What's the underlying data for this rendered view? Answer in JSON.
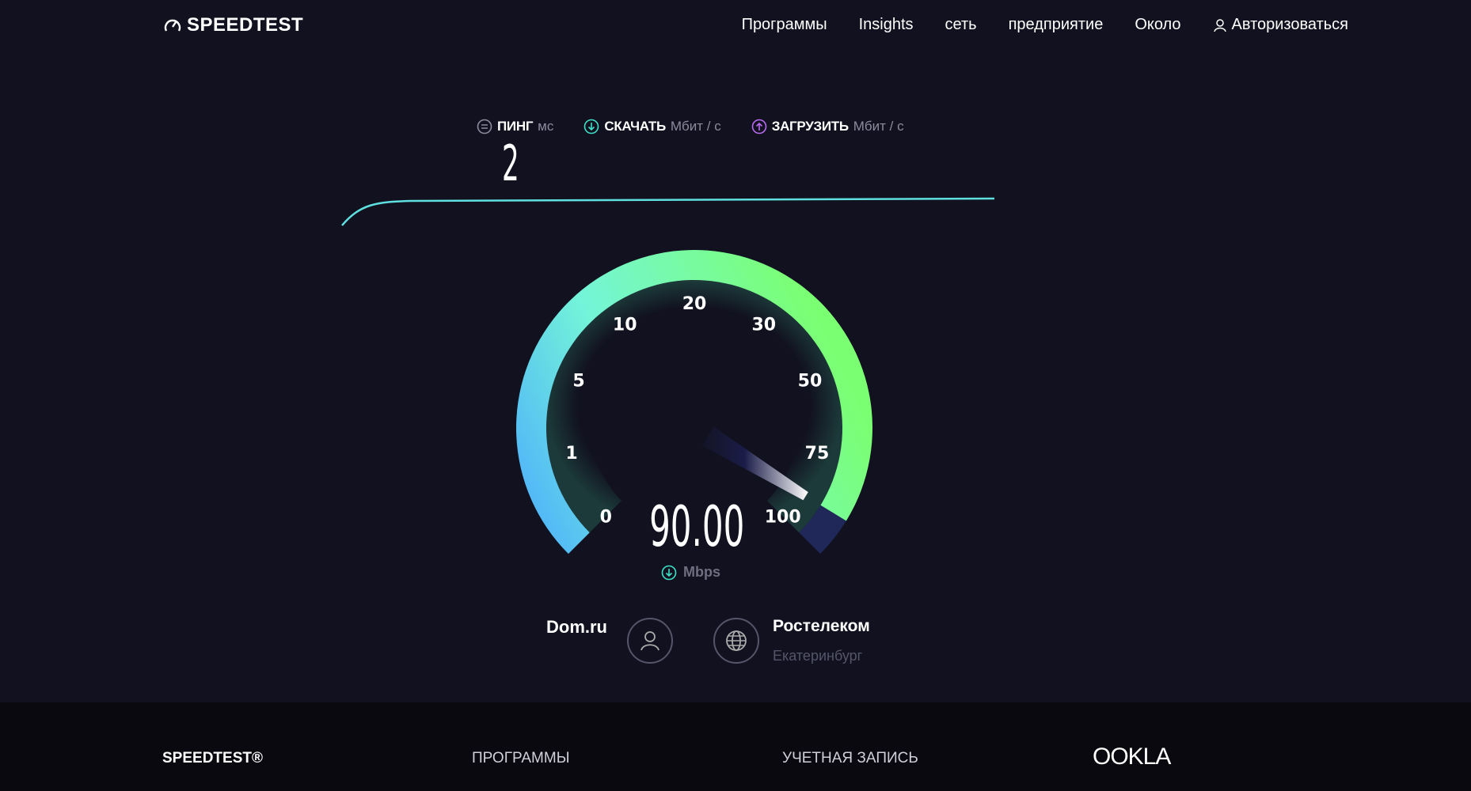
{
  "header": {
    "logo": "SPEEDTEST",
    "nav": [
      "Программы",
      "Insights",
      "сеть",
      "предприятие",
      "Около",
      "Авторизоваться"
    ]
  },
  "metrics": {
    "ping": {
      "label": "ПИНГ",
      "unit": "мс",
      "value": "2",
      "icon": "ping-icon"
    },
    "download": {
      "label": "СКАЧАТЬ",
      "unit": "Мбит / с",
      "icon": "download-icon",
      "color": "#3ee0c8"
    },
    "upload": {
      "label": "ЗАГРУЗИТЬ",
      "unit": "Мбит / с",
      "icon": "upload-icon",
      "color": "#b86bf0"
    }
  },
  "gauge": {
    "ticks": [
      "0",
      "1",
      "5",
      "10",
      "20",
      "30",
      "50",
      "75",
      "100"
    ],
    "value": 90,
    "value_text": "90.00",
    "unit": "Mbps",
    "colors": {
      "start": "#4aa8ff",
      "mid": "#74f5d8",
      "end": "#7bff72",
      "remaining": "#1f2858"
    }
  },
  "connection": {
    "isp": "Dom.ru",
    "server": "Ростелеком",
    "city": "Екатеринбург"
  },
  "footer": {
    "logo": "SPEEDTEST®",
    "apps": "ПРОГРАММЫ",
    "account": "УЧЕТНАЯ ЗАПИСЬ",
    "brand": "OOKLA"
  }
}
